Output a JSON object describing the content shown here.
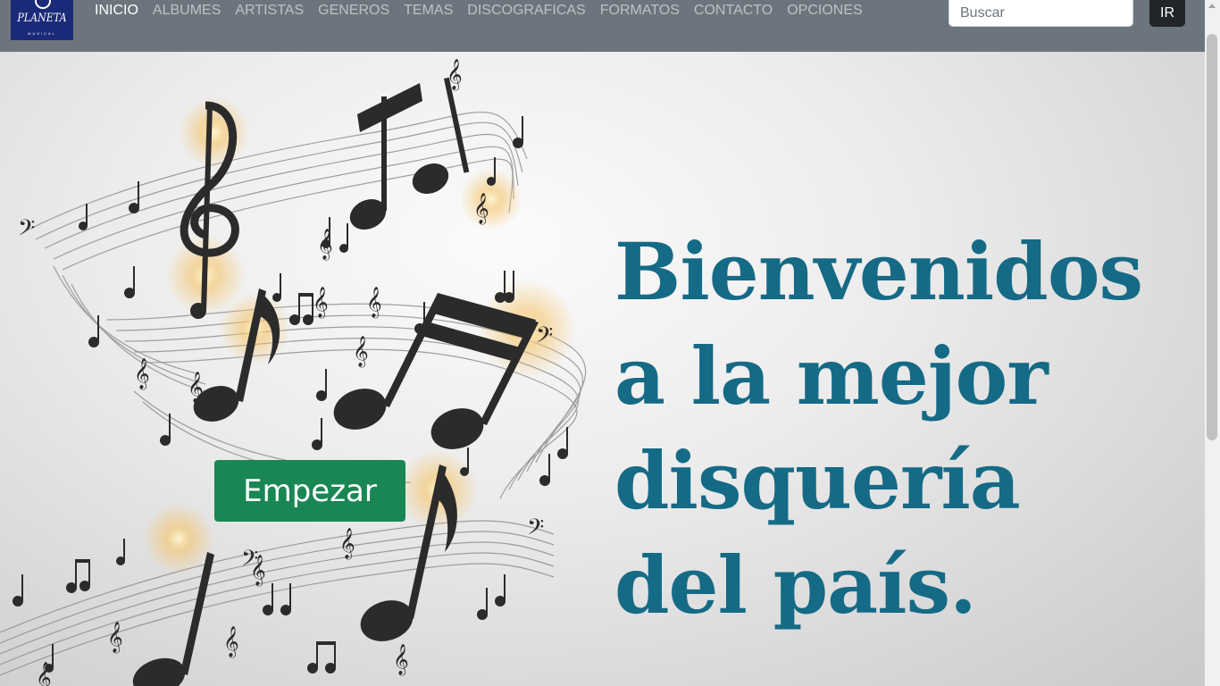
{
  "brand": {
    "name": "PLANETA",
    "subtitle": "MUSICAL"
  },
  "nav": {
    "items": [
      {
        "label": "INICIO",
        "active": true
      },
      {
        "label": "ALBUMES",
        "active": false
      },
      {
        "label": "ARTISTAS",
        "active": false
      },
      {
        "label": "GENEROS",
        "active": false
      },
      {
        "label": "TEMAS",
        "active": false
      },
      {
        "label": "DISCOGRAFICAS",
        "active": false
      },
      {
        "label": "FORMATOS",
        "active": false
      },
      {
        "label": "CONTACTO",
        "active": false
      },
      {
        "label": "OPCIONES",
        "active": false
      }
    ]
  },
  "search": {
    "placeholder": "Buscar",
    "value": "",
    "button_label": "IR"
  },
  "hero": {
    "headline_lines": [
      "Bienvenidos",
      "a la mejor",
      "disquería",
      "del país."
    ],
    "start_button_label": "Empezar"
  },
  "colors": {
    "navbar": "#6c757d",
    "headline": "#156a86",
    "start_button": "#198754",
    "search_button": "#212529",
    "brand_logo_bg": "#1a2a78"
  }
}
